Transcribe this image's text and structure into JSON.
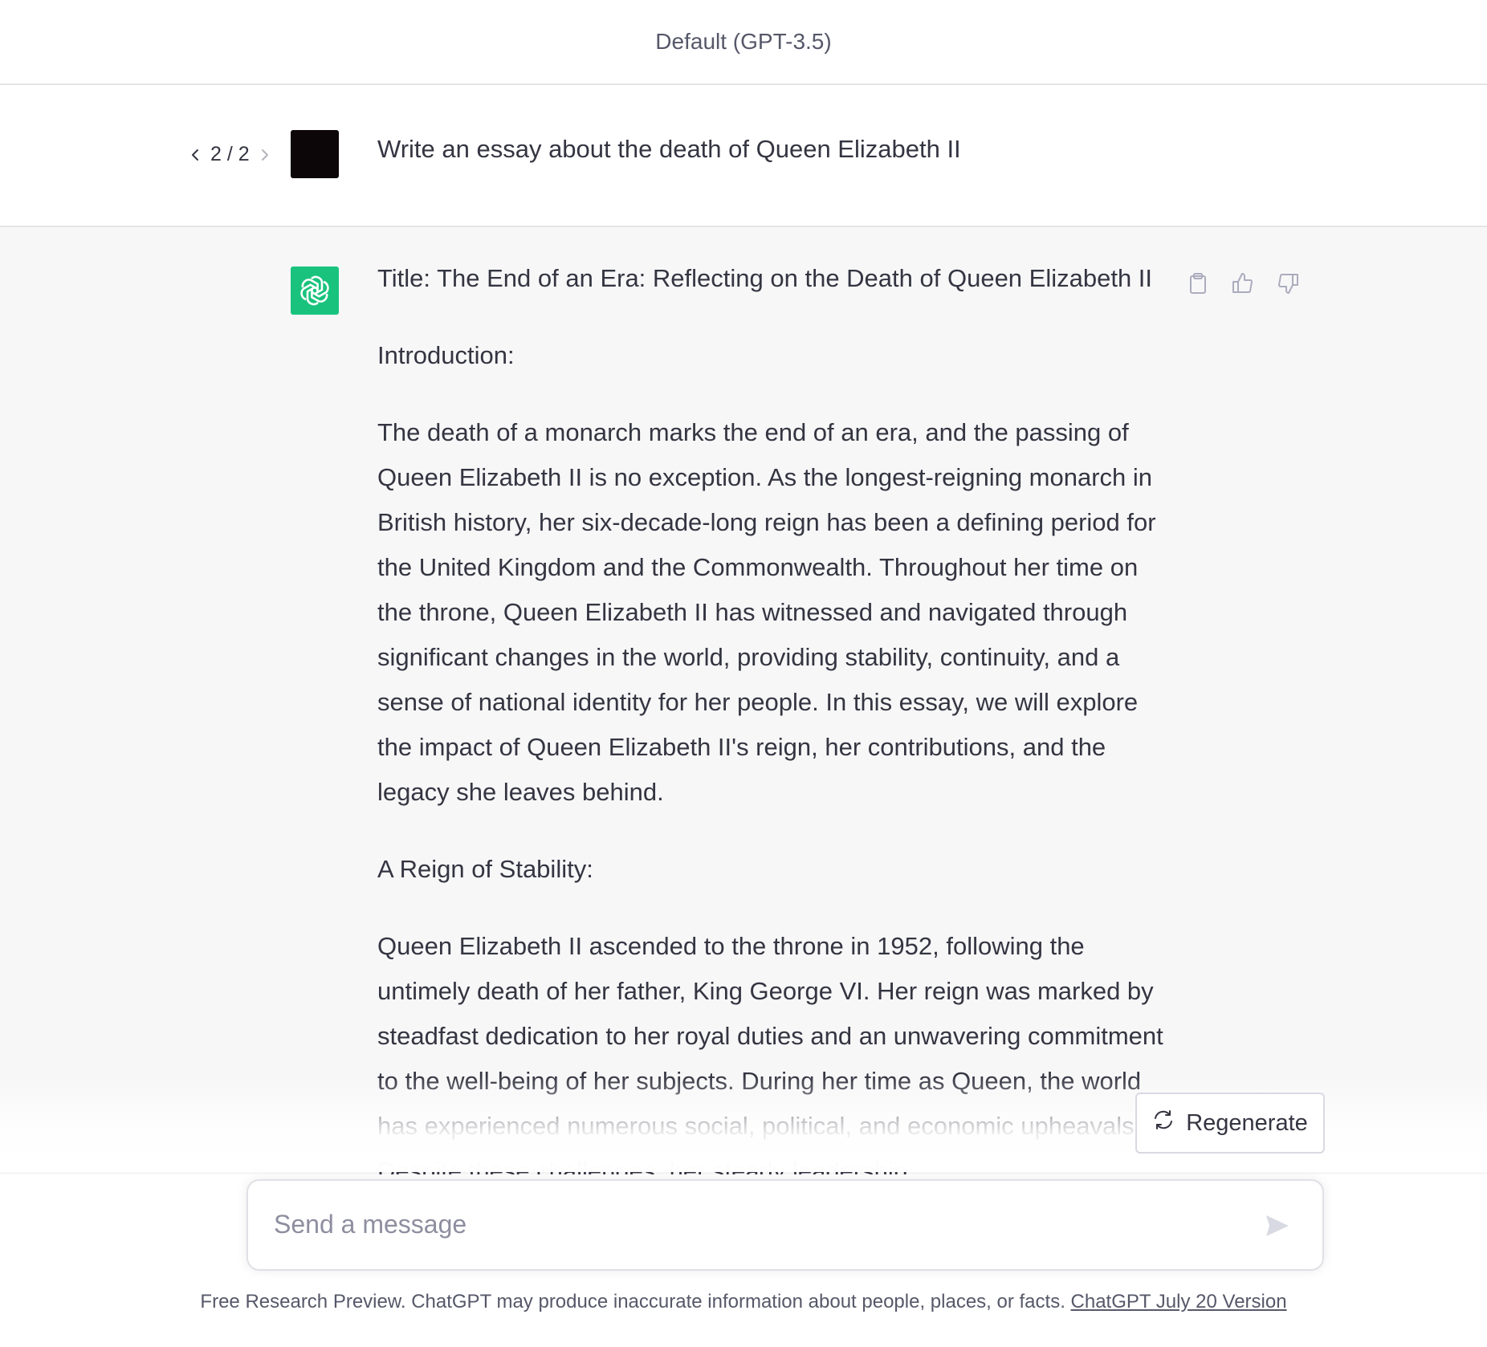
{
  "header": {
    "model_name": "Default (GPT-3.5)"
  },
  "user_message": {
    "pager": "2 / 2",
    "text": "Write an essay about the death of Queen Elizabeth II",
    "avatar_color": "#0d0609"
  },
  "assistant_message": {
    "avatar_color": "#19c37d",
    "paragraphs": [
      "Title: The End of an Era: Reflecting on the Death of Queen Elizabeth II",
      "Introduction:",
      "The death of a monarch marks the end of an era, and the passing of Queen Elizabeth II is no exception. As the longest-reigning monarch in British history, her six-decade-long reign has been a defining period for the United Kingdom and the Commonwealth. Throughout her time on the throne, Queen Elizabeth II has witnessed and navigated through significant changes in the world, providing stability, continuity, and a sense of national identity for her people. In this essay, we will explore the impact of Queen Elizabeth II's reign, her contributions, and the legacy she leaves behind.",
      "A Reign of Stability:",
      "Queen Elizabeth II ascended to the throne in 1952, following the untimely death of her father, King George VI. Her reign was marked by steadfast dedication to her royal duties and an unwavering commitment to the well-being of her subjects. During her time as Queen, the world has experienced numerous social, political, and economic upheavals. Despite these challenges, her steady leadership"
    ],
    "actions": {
      "copy_icon": "clipboard-icon",
      "like_icon": "thumbs-up-icon",
      "dislike_icon": "thumbs-down-icon"
    }
  },
  "regenerate": {
    "label": "Regenerate",
    "icon": "refresh-icon"
  },
  "composer": {
    "placeholder": "Send a message",
    "send_icon": "send-icon"
  },
  "footer": {
    "text": "Free Research Preview. ChatGPT may produce inaccurate information about people, places, or facts. ",
    "link_text": "ChatGPT July 20 Version"
  }
}
